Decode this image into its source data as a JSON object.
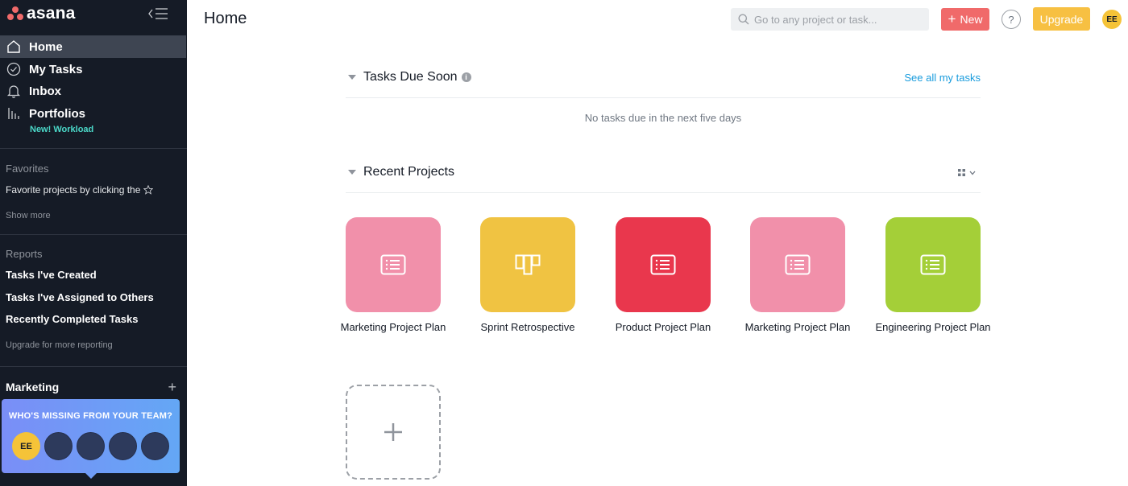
{
  "app": {
    "logo_text": "asana"
  },
  "sidebar": {
    "nav": [
      {
        "label": "Home",
        "icon": "home-icon"
      },
      {
        "label": "My Tasks",
        "icon": "check-circle-icon"
      },
      {
        "label": "Inbox",
        "icon": "bell-icon"
      },
      {
        "label": "Portfolios",
        "icon": "bar-chart-icon"
      }
    ],
    "workload_label": "New! Workload",
    "favorites": {
      "title": "Favorites",
      "hint": "Favorite projects by clicking the",
      "show_more": "Show more"
    },
    "reports": {
      "title": "Reports",
      "items": [
        "Tasks I've Created",
        "Tasks I've Assigned to Others",
        "Recently Completed Tasks"
      ],
      "upgrade_hint": "Upgrade for more reporting"
    },
    "team": {
      "name": "Marketing",
      "add_symbol": "+"
    },
    "invite": {
      "title": "WHO'S MISSING FROM YOUR TEAM?",
      "user_initials": "EE"
    }
  },
  "topbar": {
    "page_title": "Home",
    "search_placeholder": "Go to any project or task...",
    "new_label": "New",
    "help_label": "?",
    "upgrade_label": "Upgrade",
    "user_initials": "EE"
  },
  "tasks_due": {
    "title": "Tasks Due Soon",
    "info_symbol": "i",
    "see_all": "See all my tasks",
    "empty_message": "No tasks due in the next five days"
  },
  "recent_projects": {
    "title": "Recent Projects",
    "projects": [
      {
        "name": "Marketing Project Plan",
        "color": "#f190aa",
        "icon": "list-icon"
      },
      {
        "name": "Sprint Retrospective",
        "color": "#f0c342",
        "icon": "board-icon"
      },
      {
        "name": "Product Project Plan",
        "color": "#e9374d",
        "icon": "list-icon"
      },
      {
        "name": "Marketing Project Plan",
        "color": "#f190aa",
        "icon": "list-icon"
      },
      {
        "name": "Engineering Project Plan",
        "color": "#a4cf38",
        "icon": "list-icon"
      }
    ],
    "add_symbol": "+"
  },
  "colors": {
    "sidebar_bg": "#151b26",
    "accent_new": "#f06a6a",
    "accent_upgrade": "#f7c042",
    "link": "#1a9cdd",
    "workload": "#4bd9c9"
  }
}
